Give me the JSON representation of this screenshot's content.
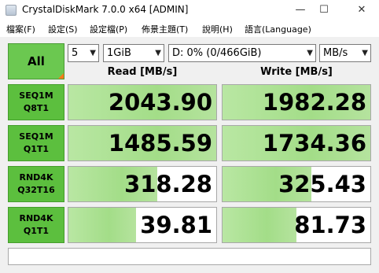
{
  "window": {
    "title": "CrystalDiskMark 7.0.0 x64 [ADMIN]",
    "minimize": "—",
    "maximize": "☐",
    "close": "✕"
  },
  "menu": {
    "items": [
      "檔案(F)",
      "設定(S)",
      "設定檔(P)",
      "佈景主題(T)",
      "說明(H)",
      "語言(Language)"
    ]
  },
  "controls": {
    "all_label": "All",
    "count_value": "5",
    "size_value": "1GiB",
    "drive_value": "D: 0% (0/466GiB)",
    "unit_value": "MB/s"
  },
  "headers": {
    "read": "Read [MB/s]",
    "write": "Write [MB/s]"
  },
  "rows": [
    {
      "line1": "SEQ1M",
      "line2": "Q8T1",
      "read": "2043.90",
      "write": "1982.28"
    },
    {
      "line1": "SEQ1M",
      "line2": "Q1T1",
      "read": "1485.59",
      "write": "1734.36"
    },
    {
      "line1": "RND4K",
      "line2": "Q32T16",
      "read": "318.28",
      "write": "325.43"
    },
    {
      "line1": "RND4K",
      "line2": "Q1T1",
      "read": "39.81",
      "write": "81.73"
    }
  ],
  "comment": ""
}
